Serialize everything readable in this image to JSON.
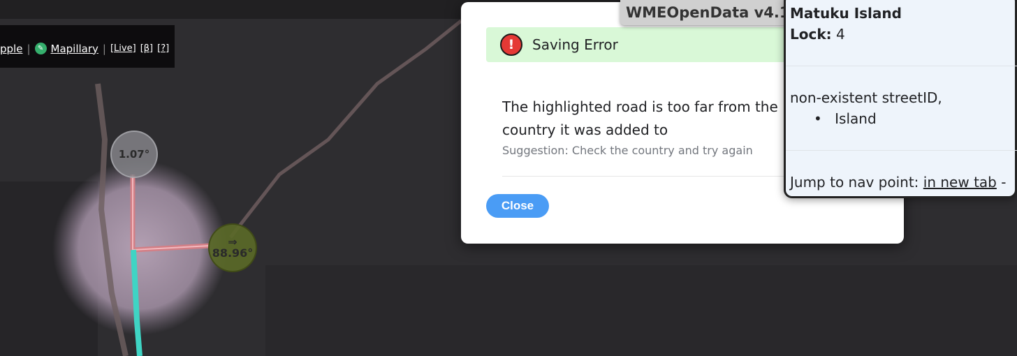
{
  "imagery_bar": {
    "apple_label": "pple",
    "mapillary_label": "Mapillary",
    "live_label": "[Live]",
    "beta_label": "[β]",
    "help_label": "[?]"
  },
  "map": {
    "angle_markers": [
      {
        "arrow": "",
        "value": "1.07°"
      },
      {
        "arrow": "⇒",
        "value": "88.96°"
      }
    ]
  },
  "dialog": {
    "title": "Saving Error",
    "message": "The highlighted road is too far from the country it was added to",
    "suggestion": "Suggestion: Check the country and try again",
    "close_label": "Close"
  },
  "wmeopendata": {
    "label": "WMEOpenData v4.1"
  },
  "info_panel": {
    "name": "Matuku Island",
    "lock_label": "Lock:",
    "lock_value": "4",
    "street_note": "non-existent streetID,",
    "bullet": "Island",
    "jump_label": "Jump to nav point:",
    "jump_link": "in new tab",
    "jump_suffix": "-"
  },
  "colors": {
    "error_icon": "#e53935",
    "header_bg": "#d9f8d7",
    "close_button": "#4a9cf5",
    "highlight_road": "#3fd4c4"
  }
}
